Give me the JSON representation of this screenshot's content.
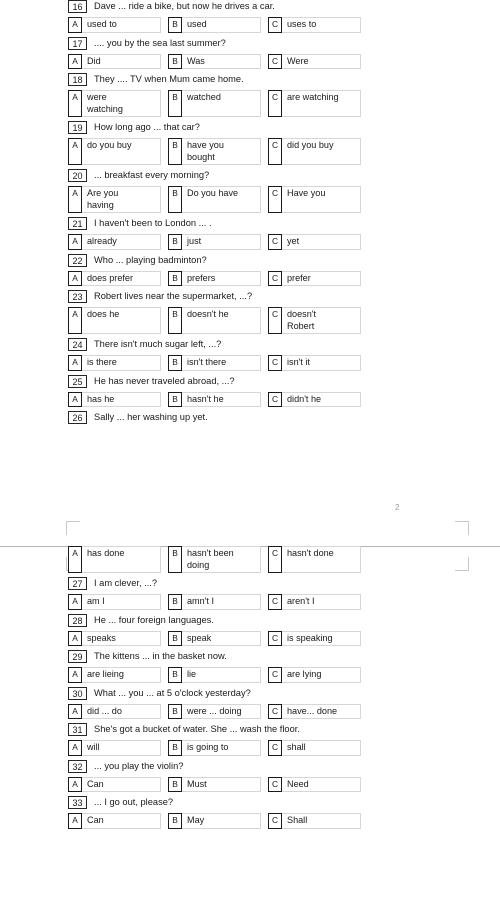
{
  "document": {
    "page_number": "2",
    "option_letters": [
      "A",
      "B",
      "C"
    ]
  },
  "page_top": {
    "questions": [
      {
        "number": "16",
        "text": "Dave ...  ride a bike, but now he drives a car.",
        "options": [
          "used to",
          "used",
          "uses to"
        ],
        "tall": false
      },
      {
        "number": "17",
        "text": ".... you by the sea last summer?",
        "options": [
          "Did",
          "Was",
          "Were"
        ],
        "tall": false
      },
      {
        "number": "18",
        "text": "They .... TV when Mum came home.",
        "options": [
          "were\nwatching",
          "watched",
          "are watching"
        ],
        "tall": true
      },
      {
        "number": "19",
        "text": "How long ago ... that car?",
        "options": [
          "do you buy",
          "have you\nbought",
          "did you buy"
        ],
        "tall": true
      },
      {
        "number": "20",
        "text": "... breakfast every morning?",
        "options": [
          "Are you\nhaving",
          "Do you have",
          "Have you"
        ],
        "tall": true
      },
      {
        "number": "21",
        "text": "I haven't been to London ... .",
        "options": [
          "already",
          "just",
          "yet"
        ],
        "tall": false
      },
      {
        "number": "22",
        "text": "Who ... playing badminton?",
        "options": [
          "does prefer",
          "prefers",
          "prefer"
        ],
        "tall": false
      },
      {
        "number": "23",
        "text": "Robert lives near the supermarket, ...?",
        "options": [
          "does he",
          "doesn't he",
          "doesn't\nRobert"
        ],
        "tall": true
      },
      {
        "number": "24",
        "text": "There isn't much sugar left, ...?",
        "options": [
          "is there",
          "isn't there",
          "isn't it"
        ],
        "tall": false
      },
      {
        "number": "25",
        "text": "He has never traveled abroad, ...?",
        "options": [
          "has he",
          "hasn't he",
          "didn't he"
        ],
        "tall": false
      },
      {
        "number": "26",
        "text": "Sally ... her washing up yet.",
        "options": [],
        "tall": false
      }
    ]
  },
  "page_bottom": {
    "continued_options": {
      "options": [
        "has done",
        "hasn't been\ndoing",
        "hasn't done"
      ],
      "tall": true
    },
    "questions": [
      {
        "number": "27",
        "text": "I am clever, ...?",
        "options": [
          "am I",
          "amn't I",
          "aren't I"
        ],
        "tall": false
      },
      {
        "number": "28",
        "text": "He ... four foreign languages.",
        "options": [
          "speaks",
          "speak",
          "is speaking"
        ],
        "tall": false
      },
      {
        "number": "29",
        "text": "The kittens ... in the basket now.",
        "options": [
          "are lieing",
          "lie",
          "are lying"
        ],
        "tall": false
      },
      {
        "number": "30",
        "text": "What ... you ... at 5 o'clock yesterday?",
        "options": [
          "did ... do",
          "were ... doing",
          "have... done"
        ],
        "tall": false
      },
      {
        "number": "31",
        "text": "She's got a bucket of water. She ... wash the floor.",
        "options": [
          "will",
          "is going to",
          "shall"
        ],
        "tall": false
      },
      {
        "number": "32",
        "text": "... you play the violin?",
        "options": [
          "Can",
          "Must",
          "Need"
        ],
        "tall": false
      },
      {
        "number": "33",
        "text": "... I go out, please?",
        "options": [
          "Can",
          "May",
          "Shall"
        ],
        "tall": false
      }
    ]
  }
}
